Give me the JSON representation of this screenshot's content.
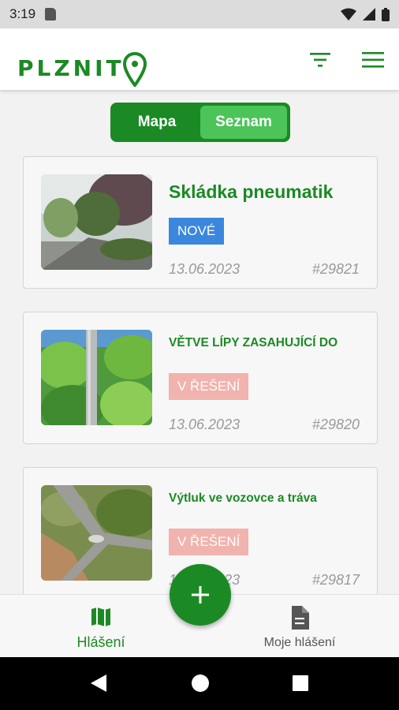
{
  "status_bar": {
    "time": "3:19"
  },
  "app": {
    "logo_text": "PLZNIT",
    "brand_color": "#1b8a24",
    "filter_icon": "filter-icon",
    "menu_icon": "hamburger-menu-icon"
  },
  "view_toggle": {
    "options": [
      {
        "label": "Mapa",
        "selected": false
      },
      {
        "label": "Seznam",
        "selected": true
      }
    ]
  },
  "reports": [
    {
      "title": "Skládka pneumatik",
      "status": "NOVÉ",
      "status_color": "#3b87dd",
      "date": "13.06.2023",
      "id": "#29821"
    },
    {
      "title": "VĚTVE LÍPY ZASAHUJÍCÍ DO",
      "status": "V ŘEŠENÍ",
      "status_color": "#f1b3ad",
      "date": "13.06.2023",
      "id": "#29820"
    },
    {
      "title": "Výtluk ve vozovce a tráva",
      "status": "V ŘEŠENÍ",
      "status_color": "#f1b3ad",
      "date": "13.06.2023",
      "id": "#29817"
    }
  ],
  "bottom_nav": {
    "items": [
      {
        "label": "Hlášení",
        "icon": "map-icon",
        "active": true
      },
      {
        "label": "Moje hlášení",
        "icon": "document-icon",
        "active": false
      }
    ],
    "fab_icon": "plus-icon"
  }
}
